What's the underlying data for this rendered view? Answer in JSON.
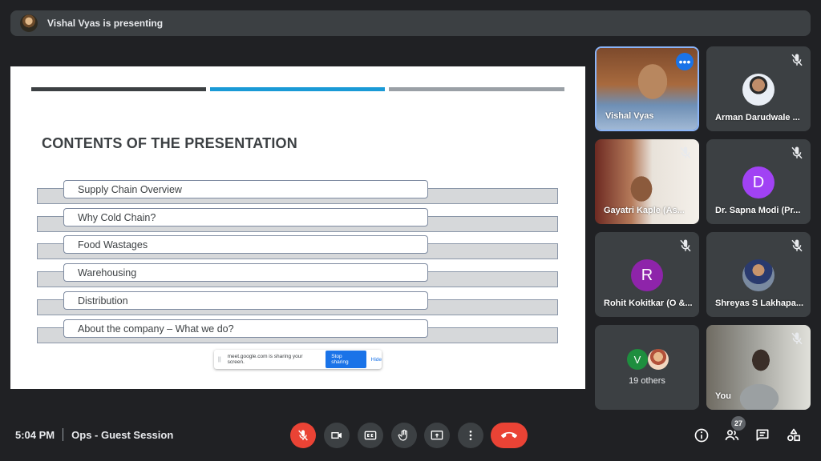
{
  "presenter": {
    "text": "Vishal Vyas is presenting"
  },
  "slide": {
    "title": "CONTENTS OF THE PRESENTATION",
    "items": [
      "Supply Chain Overview",
      "Why Cold Chain?",
      "Food Wastages",
      "Warehousing",
      "Distribution",
      "About the company – What we do?"
    ],
    "share_notice": {
      "grip": "||",
      "text": "meet.google.com is sharing your screen.",
      "stop": "Stop sharing",
      "hide": "Hide"
    }
  },
  "participants": [
    {
      "name": "Vishal Vyas",
      "type": "video"
    },
    {
      "name": "Arman Darudwale ...",
      "type": "photo"
    },
    {
      "name": "Gayatri Kaple (As...",
      "type": "video"
    },
    {
      "name": "Dr. Sapna Modi (Pr...",
      "type": "initial",
      "initial": "D",
      "color": "#a142f4"
    },
    {
      "name": "Rohit Kokitkar (O &...",
      "type": "initial",
      "initial": "R",
      "color": "#8e24aa"
    },
    {
      "name": "Shreyas S Lakhapa...",
      "type": "photo"
    },
    {
      "name": "19 others",
      "type": "others",
      "initial": "V"
    },
    {
      "name": "You",
      "type": "video"
    }
  ],
  "footer": {
    "time": "5:04 PM",
    "meeting": "Ops - Guest Session",
    "people_count": "27"
  },
  "colors": {
    "end_call": "#ea4335",
    "active_border": "#8ab4f8",
    "accent": "#1a73e8"
  }
}
